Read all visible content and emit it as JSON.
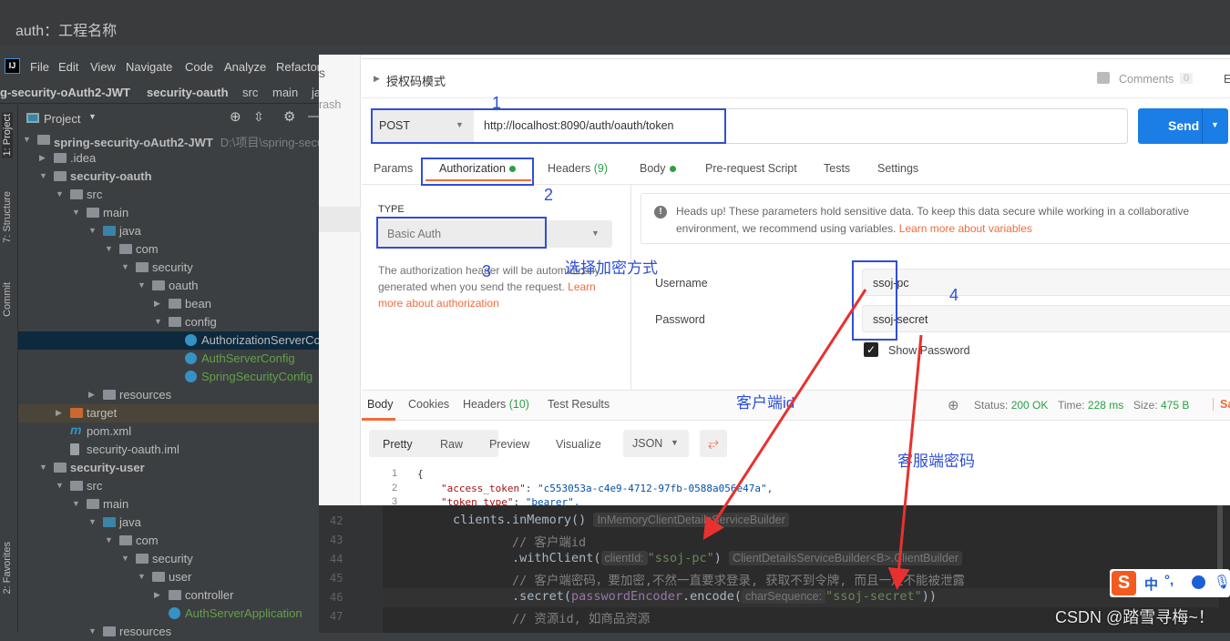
{
  "window_title": "auth：工程名称",
  "ide": {
    "menu": [
      "File",
      "Edit",
      "View",
      "Navigate",
      "Code",
      "Analyze",
      "Refactor"
    ],
    "breadcrumb": [
      "g-security-oAuth2-JWT",
      "security-oauth",
      "src",
      "main",
      "ja"
    ],
    "side_tabs": {
      "project": "1: Project",
      "structure": "7: Structure",
      "commit": "Commit",
      "favorites": "2: Favorites"
    },
    "project_label": "Project",
    "tree": [
      {
        "level": 0,
        "arrow": "down",
        "icon": "module",
        "label": "spring-security-oAuth2-JWT",
        "sub": "D:\\项目\\spring-secu",
        "style": "bold"
      },
      {
        "level": 1,
        "arrow": "right",
        "icon": "folder",
        "label": ".idea"
      },
      {
        "level": 1,
        "arrow": "down",
        "icon": "module",
        "label": "security-oauth",
        "style": "bold"
      },
      {
        "level": 2,
        "arrow": "down",
        "icon": "folder",
        "label": "src"
      },
      {
        "level": 3,
        "arrow": "down",
        "icon": "folder",
        "label": "main"
      },
      {
        "level": 4,
        "arrow": "down",
        "icon": "java",
        "label": "java"
      },
      {
        "level": 5,
        "arrow": "down",
        "icon": "package",
        "label": "com"
      },
      {
        "level": 6,
        "arrow": "down",
        "icon": "package",
        "label": "security"
      },
      {
        "level": 7,
        "arrow": "down",
        "icon": "package",
        "label": "oauth"
      },
      {
        "level": 8,
        "arrow": "right",
        "icon": "package",
        "label": "bean"
      },
      {
        "level": 8,
        "arrow": "down",
        "icon": "package",
        "label": "config"
      },
      {
        "level": 9,
        "icon": "class",
        "label": "AuthorizationServerCo",
        "selected": true
      },
      {
        "level": 9,
        "icon": "class",
        "label": "AuthServerConfig",
        "style": "green"
      },
      {
        "level": 9,
        "icon": "class",
        "label": "SpringSecurityConfig",
        "style": "green"
      },
      {
        "level": 4,
        "arrow": "right",
        "icon": "folder",
        "label": "resources"
      },
      {
        "level": 2,
        "arrow": "right",
        "icon": "target",
        "label": "target",
        "excluded": true
      },
      {
        "level": 2,
        "icon": "maven",
        "label": "pom.xml"
      },
      {
        "level": 2,
        "icon": "file",
        "label": "security-oauth.iml"
      },
      {
        "level": 1,
        "arrow": "down",
        "icon": "module",
        "label": "security-user",
        "style": "bold"
      },
      {
        "level": 2,
        "arrow": "down",
        "icon": "folder",
        "label": "src"
      },
      {
        "level": 3,
        "arrow": "down",
        "icon": "folder",
        "label": "main"
      },
      {
        "level": 4,
        "arrow": "down",
        "icon": "java",
        "label": "java"
      },
      {
        "level": 5,
        "arrow": "down",
        "icon": "package",
        "label": "com"
      },
      {
        "level": 6,
        "arrow": "down",
        "icon": "package",
        "label": "security"
      },
      {
        "level": 7,
        "arrow": "down",
        "icon": "package",
        "label": "user"
      },
      {
        "level": 8,
        "arrow": "right",
        "icon": "package",
        "label": "controller"
      },
      {
        "level": 8,
        "icon": "class",
        "label": "AuthServerApplication",
        "style": "green"
      },
      {
        "level": 4,
        "arrow": "down",
        "icon": "folder",
        "label": "resources"
      }
    ],
    "code": [
      {
        "n": "42",
        "indent": 0,
        "tokens": [
          {
            "t": "clients.inMemory() ",
            "c": "plain"
          },
          {
            "t": "InMemoryClientDetailsServiceBuilder",
            "c": "hint"
          }
        ]
      },
      {
        "n": "43",
        "indent": 1,
        "tokens": [
          {
            "t": "// 客户端id",
            "c": "comment"
          }
        ]
      },
      {
        "n": "44",
        "indent": 1,
        "tokens": [
          {
            "t": ".withClient(",
            "c": "plain"
          },
          {
            "t": "clientId:",
            "c": "hint"
          },
          {
            "t": "\"ssoj-pc\"",
            "c": "string"
          },
          {
            "t": ") ",
            "c": "plain"
          },
          {
            "t": "ClientDetailsServiceBuilder<B>.ClientBuilder",
            "c": "hint"
          }
        ]
      },
      {
        "n": "45",
        "indent": 1,
        "tokens": [
          {
            "t": "// 客户端密码，要加密,不然一直要求登录, 获取不到令牌, 而且一定不能被泄露",
            "c": "comment"
          }
        ]
      },
      {
        "n": "46",
        "indent": 1,
        "tokens": [
          {
            "t": ".secret(",
            "c": "plain"
          },
          {
            "t": "passwordEncoder",
            "c": "param"
          },
          {
            "t": ".encode(",
            "c": "plain"
          },
          {
            "t": "charSequence:",
            "c": "hint"
          },
          {
            "t": "\"ssoj-secret\"",
            "c": "string"
          },
          {
            "t": "))",
            "c": "plain"
          }
        ]
      },
      {
        "n": "47",
        "indent": 1,
        "tokens": [
          {
            "t": "// 资源id, 如商品资源",
            "c": "comment"
          }
        ]
      }
    ]
  },
  "postman": {
    "sidebar_fragments": [
      "s",
      "rash"
    ],
    "request_name": "授权码模式",
    "comments_label": "Comments",
    "comments_count": "0",
    "edit_fragment": "E",
    "method": "POST",
    "url": "http://localhost:8090/auth/oauth/token",
    "send": "Send",
    "tabs": [
      {
        "label": "Params"
      },
      {
        "label": "Authorization",
        "dot": true,
        "active": true
      },
      {
        "label": "Headers",
        "count": "(9)"
      },
      {
        "label": "Body",
        "dot": true
      },
      {
        "label": "Pre-request Script"
      },
      {
        "label": "Tests"
      },
      {
        "label": "Settings"
      }
    ],
    "type_label": "TYPE",
    "auth_type": "Basic Auth",
    "auth_desc": "The authorization header will be automatically generated when you send the request. ",
    "auth_link": "Learn more about authorization",
    "headsup": "Heads up! These parameters hold sensitive data. To keep this data secure while working in a collaborative environment, we recommend using variables. ",
    "headsup_link": "Learn more about variables",
    "username_label": "Username",
    "username": "ssoj-pc",
    "password_label": "Password",
    "password": "ssoj-secret",
    "show_password": "Show Password",
    "show_password_checked": true,
    "resp_tabs": [
      {
        "label": "Body",
        "active": true
      },
      {
        "label": "Cookies"
      },
      {
        "label": "Headers",
        "count": "(10)"
      },
      {
        "label": "Test Results"
      }
    ],
    "status_label": "Status:",
    "status": "200 OK",
    "time_label": "Time:",
    "time": "228 ms",
    "size_label": "Size:",
    "size": "475 B",
    "save_fragment": "Sav",
    "view_modes": [
      "Pretty",
      "Raw",
      "Preview",
      "Visualize"
    ],
    "format": "JSON",
    "json_lines": [
      {
        "n": "1",
        "text": "{"
      },
      {
        "n": "2",
        "key": "\"access_token\"",
        "value": "\"c553053a-c4e9-4712-97fb-0588a056e47a\","
      },
      {
        "n": "3",
        "key": "\"token_type\"",
        "value": "\"bearer\","
      }
    ]
  },
  "annotations": {
    "n1": "1",
    "n2": "2",
    "n3": "3",
    "n4": "4",
    "choose": "选择加密方式",
    "client_id": "客户端id",
    "client_secret": "客服端密码"
  },
  "ime": {
    "lang": "中",
    "punct": "°,"
  },
  "watermark": "CSDN @踏雪寻梅~！",
  "colors": {
    "send": "#1a7ee6",
    "accent": "#f26b3a",
    "annotation_box": "#2e4fd6",
    "arrow": "#e8312f",
    "status_ok": "#2aa046"
  }
}
